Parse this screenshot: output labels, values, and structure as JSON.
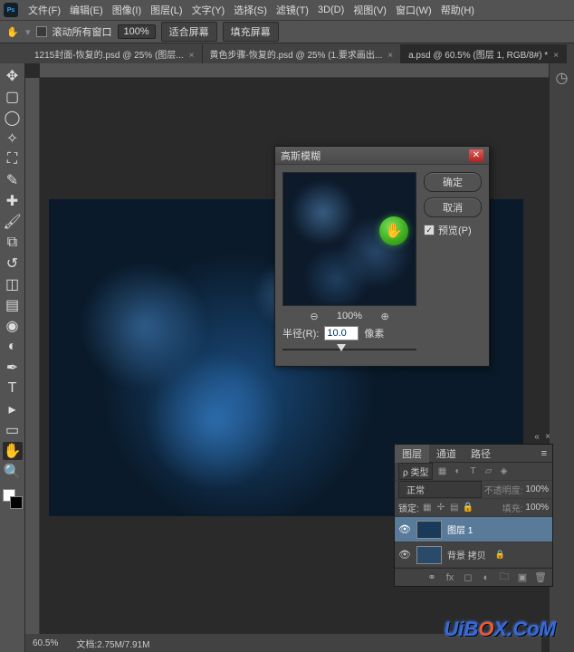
{
  "menubar": {
    "items": [
      "文件(F)",
      "编辑(E)",
      "图像(I)",
      "图层(L)",
      "文字(Y)",
      "选择(S)",
      "滤镜(T)",
      "3D(D)",
      "视图(V)",
      "窗口(W)",
      "帮助(H)"
    ]
  },
  "optbar": {
    "scroll_all": "滚动所有窗口",
    "zoom": "100%",
    "fit_screen": "适合屏幕",
    "fill_screen": "填充屏幕"
  },
  "tabs": [
    {
      "label": "1215封面-恢复的.psd @ 25% (图层..."
    },
    {
      "label": "黄色步骤-恢复的.psd @ 25% (1.要求画出..."
    },
    {
      "label": "a.psd @ 60.5% (图层 1, RGB/8#) *"
    }
  ],
  "dialog": {
    "title": "高斯模糊",
    "ok": "确定",
    "cancel": "取消",
    "preview_label": "预览(P)",
    "zoom_pct": "100%",
    "radius_label": "半径(R):",
    "radius_value": "10.0",
    "pixels": "像素"
  },
  "layers": {
    "tabs": [
      "图层",
      "通道",
      "路径"
    ],
    "kind_label": "ρ 类型",
    "blend_mode": "正常",
    "opacity_label": "不透明度:",
    "lock_label": "锁定:",
    "fill_label": "填充:",
    "opacity_val": "100%",
    "fill_val": "100%",
    "items": [
      {
        "name": "图层 1"
      },
      {
        "name": "背景 拷贝"
      }
    ]
  },
  "status": {
    "zoom": "60.5%",
    "docsize": "文档:2.75M/7.91M"
  },
  "watermark": {
    "pre": "UiB",
    "o": "O",
    "post": "X.CoM"
  }
}
